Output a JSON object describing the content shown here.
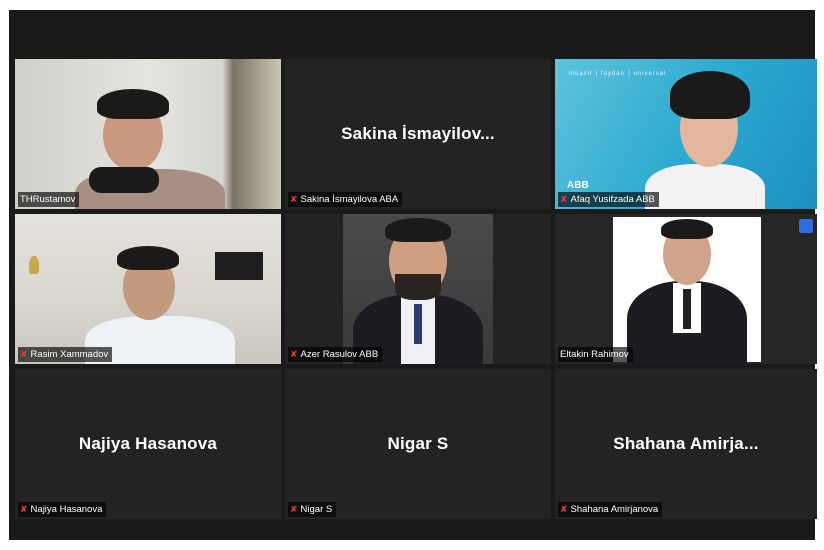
{
  "participants": [
    {
      "name": "THRustamov",
      "display": ""
    },
    {
      "name": "Sakina  İsmayilova  ABA",
      "display": "Sakina  İsmayilov..."
    },
    {
      "name": "Afaq Yusifzada ABB",
      "display": ""
    },
    {
      "name": "Rasim Xammadov",
      "display": ""
    },
    {
      "name": "Azer Rasulov ABB",
      "display": ""
    },
    {
      "name": "Eltakin Rahimov",
      "display": ""
    },
    {
      "name": "Najiya Hasanova",
      "display": "Najiya Hasanova"
    },
    {
      "name": "Nigar S",
      "display": "Nigar S"
    },
    {
      "name": "Shahana Amirjanova",
      "display": "Shahana  Amirja..."
    }
  ],
  "abb_tile": {
    "logo": "ABB",
    "slogan": "müasir  |  faydalı  |  universal"
  },
  "icons": {
    "mute": "muted-microphone-icon"
  },
  "colors": {
    "active_speaker_border": "#d6d43a",
    "mute": "#e0403a",
    "tile_bg": "#232323"
  }
}
